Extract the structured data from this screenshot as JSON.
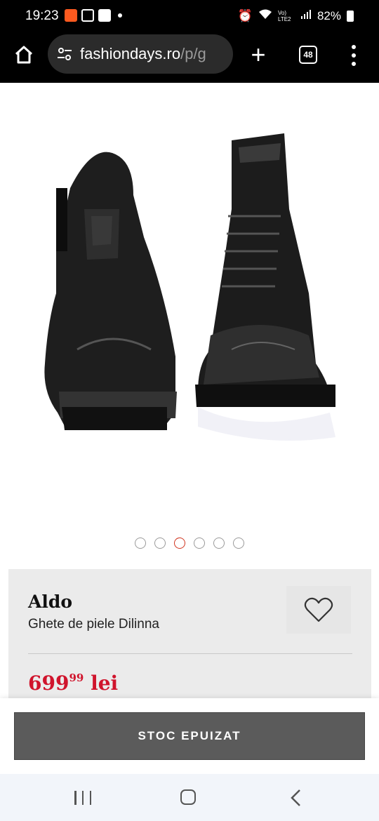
{
  "status_bar": {
    "time": "19:23",
    "network": "Vo) LTE2",
    "battery": "82%"
  },
  "browser": {
    "url_domain": "fashiondays.ro",
    "url_path": "/p/g",
    "tab_count": "48"
  },
  "gallery": {
    "image_icon": "boots-image",
    "dots_count": 6,
    "active_dot_index": 2
  },
  "product": {
    "brand": "Aldo",
    "name": "Ghete de piele Dilinna",
    "price_main": "699",
    "price_cents": "99",
    "price_currency": "lei"
  },
  "actions": {
    "stock_button": "STOC EPUIZAT"
  },
  "colors": {
    "price": "#d0142c",
    "active_dot": "#d0341f",
    "button_bg": "#5b5b5b"
  }
}
